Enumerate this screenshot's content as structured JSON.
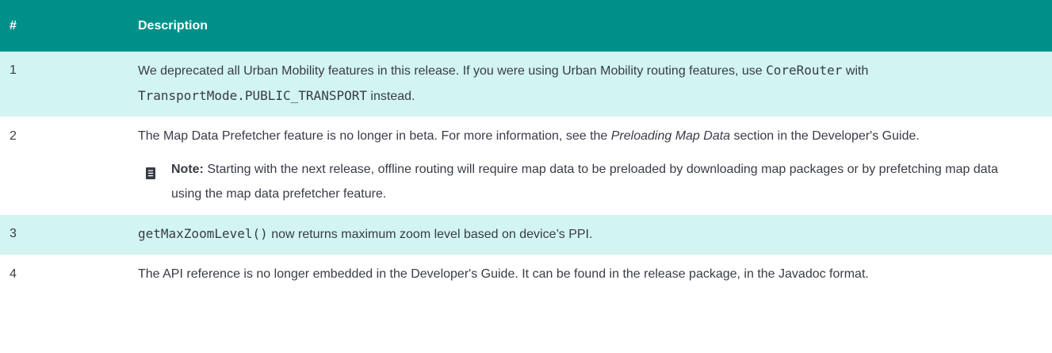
{
  "header": {
    "num": "#",
    "description": "Description"
  },
  "rows": [
    {
      "num": "1",
      "pre": "We deprecated all Urban Mobility features in this release. If you were using Urban Mobility routing features, use ",
      "code1": "CoreRouter",
      "mid": " with ",
      "code2": "TransportMode.PUBLIC_TRANSPORT",
      "post": " instead."
    },
    {
      "num": "2",
      "pre": "The Map Data Prefetcher feature is no longer in beta. For more information, see the ",
      "em": "Preloading Map Data",
      "post": " section in the Developer's Guide.",
      "note_label": "Note:",
      "note_text": " Starting with the next release, offline routing will require map data to be preloaded by downloading map packages or by prefetching map data using the map data prefetcher feature."
    },
    {
      "num": "3",
      "code": "getMaxZoomLevel()",
      "text": " now returns maximum zoom level based on device’s PPI."
    },
    {
      "num": "4",
      "text": "The API reference is no longer embedded in the Developer's Guide. It can be found in the release package, in the Javadoc format."
    }
  ],
  "colors": {
    "header_bg": "#00908a",
    "row_alt_bg": "#d2f4f3",
    "text": "#383c45"
  },
  "icons": {
    "note": "document-note-icon"
  }
}
